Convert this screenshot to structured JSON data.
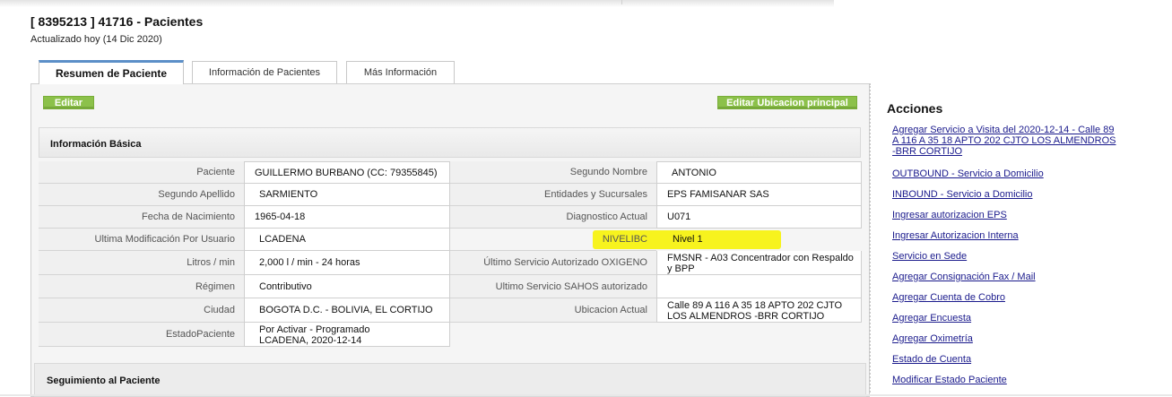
{
  "header": {
    "title": "[ 8395213 ] 41716 - Pacientes",
    "updated": "Actualizado hoy (14 Dic 2020)"
  },
  "tabs": [
    {
      "label": "Resumen de Paciente",
      "active": true
    },
    {
      "label": "Información de Pacientes",
      "active": false
    },
    {
      "label": "Más Información",
      "active": false
    }
  ],
  "buttons": {
    "edit": "Editar",
    "edit_location": "Editar Ubicacion principal"
  },
  "basic_info": {
    "title": "Información Básica",
    "left": [
      {
        "label": "Paciente",
        "value": "GUILLERMO BURBANO (CC: 79355845)"
      },
      {
        "label": "Segundo Apellido",
        "value": "SARMIENTO"
      },
      {
        "label": "Fecha de Nacimiento",
        "value": "1965-04-18"
      },
      {
        "label": "Ultima Modificación Por Usuario",
        "value": "LCADENA"
      },
      {
        "label": "Litros / min",
        "value": "2,000 l / min - 24 horas"
      },
      {
        "label": "Régimen",
        "value": "Contributivo"
      },
      {
        "label": "Ciudad",
        "value": "BOGOTA D.C. - BOLIVIA, EL CORTIJO"
      },
      {
        "label": "EstadoPaciente",
        "value": "Por Activar - Programado",
        "value2": "LCADENA, 2020-12-14"
      }
    ],
    "right": [
      {
        "label": "Segundo Nombre",
        "value": "ANTONIO"
      },
      {
        "label": "Entidades y Sucursales",
        "value": "EPS FAMISANAR SAS"
      },
      {
        "label": "Diagnostico Actual",
        "value": "U071"
      },
      {
        "label": "NIVELIBC",
        "value": "Nivel 1",
        "highlight": "#f7f31e"
      },
      {
        "label": "Último Servicio Autorizado OXIGENO",
        "value": "FMSNR - A03 Concentrador con Respaldo",
        "value2": "y BPP"
      },
      {
        "label": "Ultimo Servicio SAHOS autorizado",
        "value": ""
      },
      {
        "label": "Ubicacion Actual",
        "value": "Calle 89 A 116 A 35 18 APTO 202 CJTO",
        "value2": "LOS ALMENDROS -BRR CORTIJO"
      }
    ]
  },
  "followup": {
    "title": "Seguimiento al Paciente"
  },
  "actions": {
    "title": "Acciones",
    "visit_link": {
      "line1": "Agregar Servicio a Visita del 2020-12-14 - Calle 89",
      "line2": "A 116 A 35 18 APTO 202 CJTO LOS ALMENDROS",
      "line3": "-BRR CORTIJO"
    },
    "items": [
      "OUTBOUND - Servicio a Domicilio",
      "INBOUND - Servicio a Domicilio",
      "Ingresar autorizacion EPS",
      "Ingresar Autorizacion Interna",
      "Servicio en Sede",
      "Agregar Consignación Fax / Mail",
      "Agregar Cuenta de Cobro",
      "Agregar Encuesta",
      "Agregar Oximetría",
      "Estado de Cuenta",
      "Modificar Estado Paciente"
    ]
  },
  "colors": {
    "button_green": "#8cc14a",
    "tab_active_accent": "#5c8fc8",
    "link": "#1a1a8c",
    "highlight": "#f7f31e"
  }
}
